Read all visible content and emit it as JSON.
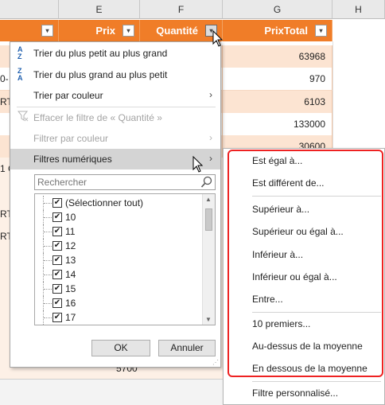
{
  "columns": {
    "e": "E",
    "f": "F",
    "g": "G",
    "h": "H"
  },
  "table_headers": {
    "prix": "Prix",
    "quantite": "Quantité",
    "prixtotal": "PrixTotal"
  },
  "filter_button_glyph": "▾",
  "rows": [
    {
      "left_fragment": "",
      "prixtotal": "63968"
    },
    {
      "left_fragment": "0-",
      "prixtotal": "970"
    },
    {
      "left_fragment": "RT",
      "prixtotal": "6103"
    },
    {
      "left_fragment": "",
      "prixtotal": "133000"
    },
    {
      "left_fragment": "",
      "prixtotal": "30600"
    }
  ],
  "side_fragments": [
    "1 G",
    "RT",
    "RT"
  ],
  "bottom_value": "5700",
  "menu": {
    "sort_asc": "Trier du plus petit au plus grand",
    "sort_desc": "Trier du plus grand au plus petit",
    "sort_color": "Trier par couleur",
    "clear_filter": "Effacer le filtre de « Quantité »",
    "filter_color": "Filtrer par couleur",
    "number_filters": "Filtres numériques",
    "sort_asc_icon_top": "A",
    "sort_asc_icon_bottom": "Z",
    "sort_desc_icon_top": "Z",
    "sort_desc_icon_bottom": "A",
    "arrow": "›"
  },
  "search": {
    "placeholder": "Rechercher"
  },
  "checklist": {
    "check_glyph": "✔",
    "items": [
      "(Sélectionner tout)",
      "10",
      "11",
      "12",
      "13",
      "14",
      "15",
      "16",
      "17"
    ]
  },
  "buttons": {
    "ok": "OK",
    "cancel": "Annuler"
  },
  "submenu": {
    "items": [
      "Est égal à...",
      "Est différent de...",
      "Supérieur à...",
      "Supérieur ou égal à...",
      "Inférieur à...",
      "Inférieur ou égal à...",
      "Entre...",
      "10 premiers...",
      "Au-dessus de la moyenne",
      "En dessous de la moyenne",
      "Filtre personnalisé..."
    ]
  },
  "colors": {
    "header_orange": "#f07d28",
    "row_orange": "#fce4d2",
    "highlight_frame": "#e22222",
    "menu_hover": "#d4d4d4"
  }
}
